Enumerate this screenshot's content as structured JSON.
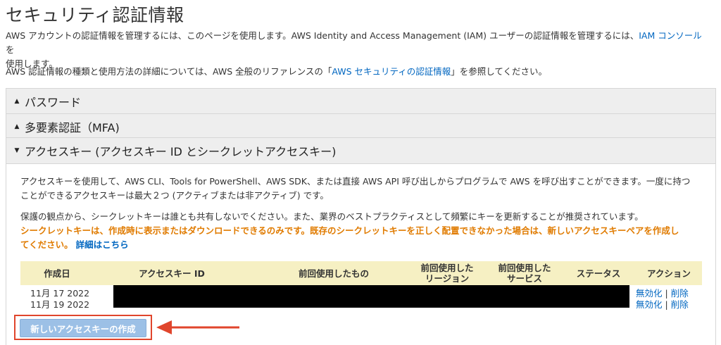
{
  "page": {
    "title": "セキュリティ認証情報",
    "intro1_text": "AWS アカウントの認証情報を管理するには、このページを使用します。AWS Identity and Access Management (IAM) ユーザーの認証情報を管理するには、",
    "intro1_link": "IAM コンソール",
    "intro1_tail": " を",
    "intro1_line2": "使用します。",
    "intro2_text": "AWS 認証情報の種類と使用方法の詳細については、AWS 全般のリファレンスの「",
    "intro2_link": "AWS セキュリティの認証情報",
    "intro2_tail": "」を参照してください。"
  },
  "panels": [
    {
      "label": "パスワード",
      "state": "collapsed",
      "arrow": "▲"
    },
    {
      "label": "多要素認証（MFA)",
      "state": "collapsed",
      "arrow": "▲"
    },
    {
      "label": "アクセスキー (アクセスキー ID とシークレットアクセスキー)",
      "state": "expanded",
      "arrow": "▼"
    }
  ],
  "access_keys": {
    "desc_line1": "アクセスキーを使用して、AWS CLI、Tools for PowerShell、AWS SDK、または直接 AWS API 呼び出しからプログラムで AWS を呼び出すことができます。一度に持つ",
    "desc_line2": "ことができるアクセスキーは最大２つ (アクティブまたは非アクティブ) です。",
    "security_note": "保護の観点から、シークレットキーは誰とも共有しないでください。また、業界のベストプラクティスとして頻繁にキーを更新することが推奨されています。",
    "warning_line1": "シークレットキーは、作成時に表示またはダウンロードできるのみです。既存のシークレットキーを正しく配置できなかった場合は、新しいアクセスキーペアを作成し",
    "warning_line2": "てください。",
    "details_link": "詳細はこちら",
    "columns": [
      "作成日",
      "アクセスキー ID",
      "前回使用したもの",
      "前回使用した\nリージョン",
      "前回使用した\nサービス",
      "ステータス",
      "アクション"
    ],
    "rows": [
      {
        "created": "11月 17 2022",
        "disable": "無効化",
        "delete": "削除"
      },
      {
        "created": "11月 19 2022",
        "disable": "無効化",
        "delete": "削除"
      }
    ],
    "separator": "|",
    "create_button": "新しいアクセスキーの作成"
  },
  "colors": {
    "link": "#0066c0",
    "warning": "#e07b00",
    "table_header_bg": "#f6f0c3",
    "highlight": "#e0452c",
    "button_bg": "#9cc0e6"
  }
}
